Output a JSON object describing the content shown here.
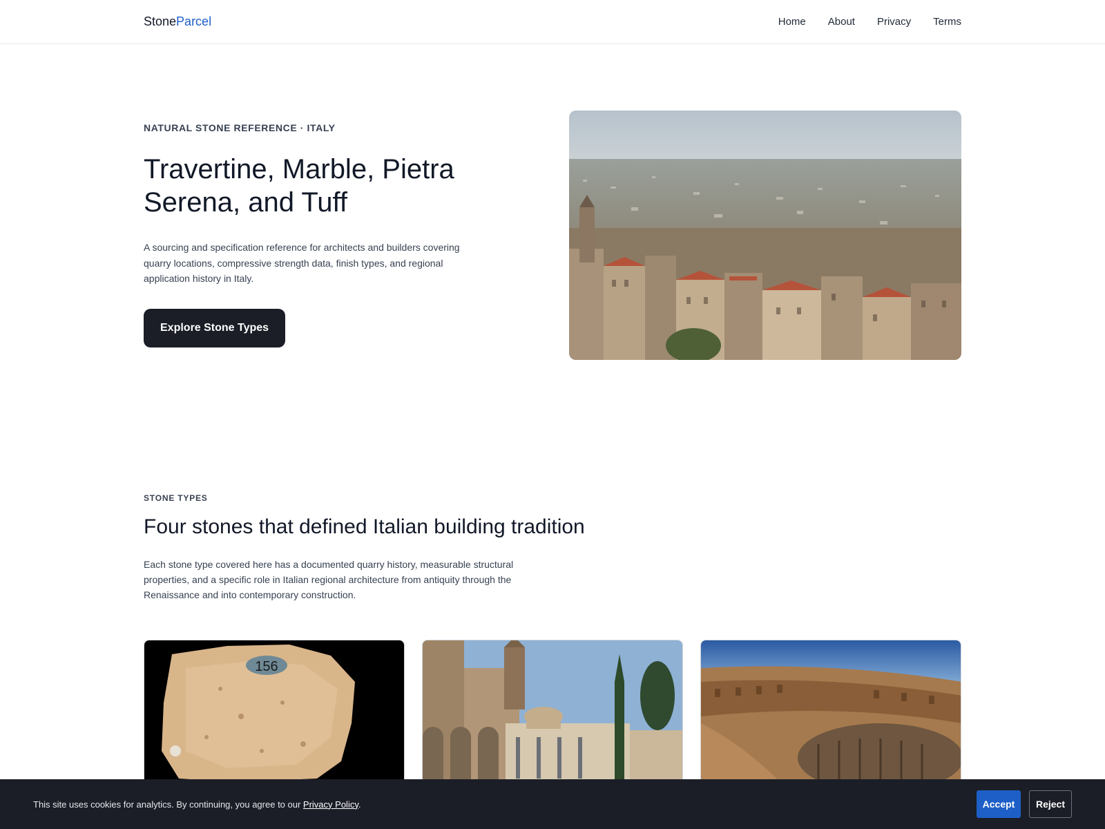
{
  "nav": {
    "brand_part1": "Stone",
    "brand_part2": "Parcel",
    "links": [
      "Home",
      "About",
      "Privacy",
      "Terms"
    ]
  },
  "hero": {
    "eyebrow": "NATURAL STONE REFERENCE · ITALY",
    "title": "Travertine, Marble, Pietra Serena, and Tuff",
    "description": "A sourcing and specification reference for architects and builders covering quarry locations, compressive strength data, finish types, and regional application history in Italy.",
    "cta_label": "Explore Stone Types"
  },
  "section": {
    "eyebrow": "STONE TYPES",
    "title": "Four stones that defined Italian building tradition",
    "description": "Each stone type covered here has a documented quarry history, measurable structural properties, and a specific role in Italian regional architecture from antiquity through the Renaissance and into contemporary construction."
  },
  "cards": {
    "sample_label": "156"
  },
  "cookie": {
    "text": "This site uses cookies for analytics. By continuing, you agree to our ",
    "link_text": "Privacy Policy",
    "suffix": ".",
    "accept_label": "Accept",
    "reject_label": "Reject"
  }
}
